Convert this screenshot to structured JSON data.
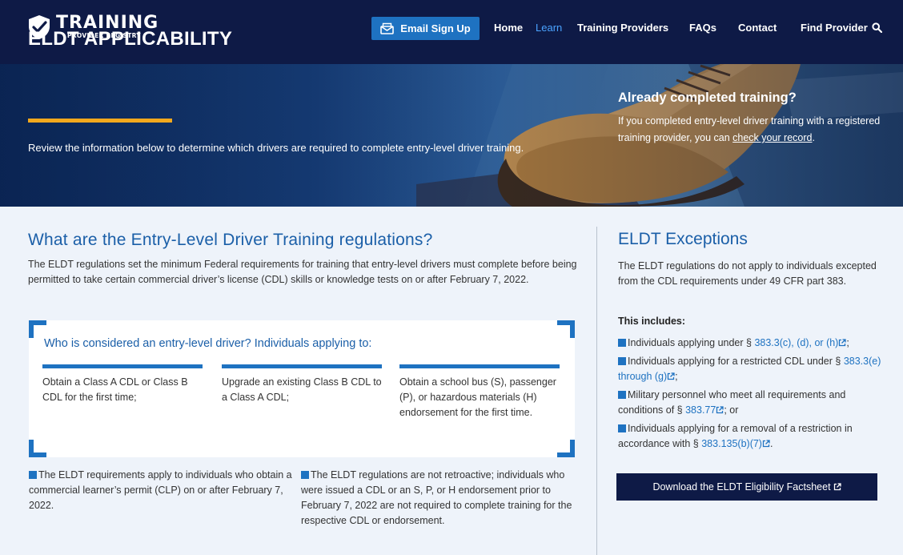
{
  "header": {
    "logo_main": "TRAINING",
    "logo_sub": "PROVIDER REGISTRY",
    "email_button": "Email Sign Up",
    "nav": [
      "Home",
      "Learn",
      "Training Providers",
      "FAQs",
      "Contact",
      "Find Provider"
    ]
  },
  "hero": {
    "title": "ELDT APPLICABILITY",
    "description": "Review the information below to determine which drivers are required to complete entry-level driver training.",
    "right_title": "Already completed training?",
    "right_text_before": "If you completed entry-level driver training with a registered training provider, you can ",
    "right_link": "check your record",
    "right_text_after": "."
  },
  "main": {
    "title": "What are the Entry-Level Driver Training regulations?",
    "intro": "The ELDT regulations set the minimum Federal requirements for training that entry-level drivers must complete before being permitted to take certain commercial driver’s license (CDL) skills or knowledge tests on or after February 7, 2022.",
    "callout_title": "Who is considered an entry-level driver? Individuals applying to:",
    "callout_items": [
      "Obtain a Class A CDL or Class B CDL for the first time;",
      "Upgrade an existing Class B CDL to a Class A CDL;",
      "Obtain a school bus (S), passenger (P), or hazardous materials (H) endorsement for the first time."
    ],
    "bullets": [
      "The ELDT requirements apply to individuals who obtain a commercial learner’s permit (CLP) on or after February 7, 2022.",
      "The ELDT regulations are not retroactive; individuals who were issued a CDL or an S, P, or H endorsement prior to February 7, 2022 are not required to complete training for the respective CDL or endorsement."
    ]
  },
  "exceptions": {
    "title": "ELDT Exceptions",
    "intro": "The ELDT regulations do not apply to individuals excepted from the CDL requirements under 49 CFR part 383.",
    "includes_label": "This includes:",
    "items": [
      {
        "before": "Individuals applying under § ",
        "link": "383.3(c), (d), or (h)",
        "after": ";"
      },
      {
        "before": "Individuals applying for a restricted CDL under § ",
        "link": "383.3(e) through (g)",
        "after": ";"
      },
      {
        "before": "Military personnel who meet all requirements and conditions of § ",
        "link": "383.77",
        "after": "; or"
      },
      {
        "before": "Individuals applying for a removal of a restriction in accordance with § ",
        "link": "383.135(b)(7)",
        "after": "."
      }
    ],
    "download_button": "Download the ELDT Eligibility Factsheet"
  },
  "colors": {
    "navy": "#0e1a46",
    "accent_blue": "#1e72c1",
    "heading_blue": "#1b5fa8",
    "hero_underline": "#f2a81d",
    "page_bg": "#eef3fa"
  }
}
